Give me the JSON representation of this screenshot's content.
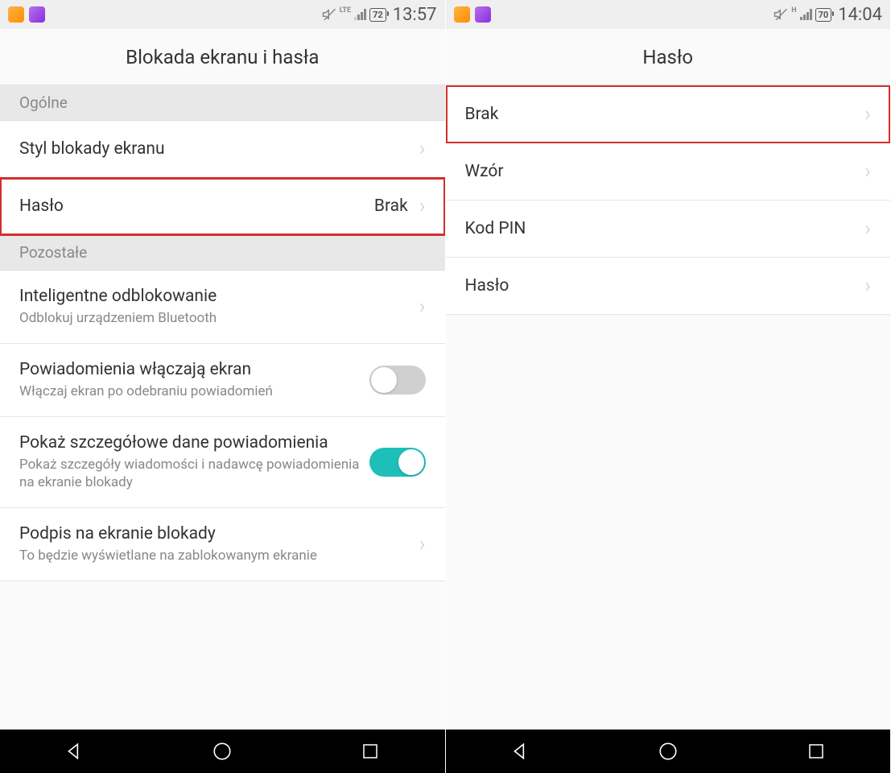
{
  "left": {
    "status": {
      "network_type": "LTE",
      "battery": "72",
      "time": "13:57"
    },
    "header": {
      "title": "Blokada ekranu i hasła"
    },
    "section1": {
      "label": "Ogólne"
    },
    "section2": {
      "label": "Pozostałe"
    },
    "rows": {
      "lockstyle": {
        "title": "Styl blokady ekranu"
      },
      "password": {
        "title": "Hasło",
        "value": "Brak"
      },
      "smartunlock": {
        "title": "Inteligentne odblokowanie",
        "subtitle": "Odblokuj urządzeniem Bluetooth"
      },
      "notif_screen": {
        "title": "Powiadomienia włączają ekran",
        "subtitle": "Włączaj ekran po odebraniu powiadomień"
      },
      "notif_detail": {
        "title": "Pokaż szczegółowe dane powiadomienia",
        "subtitle": "Pokaż szczegóły wiadomości i nadawcę powiadomienia na ekranie blokady"
      },
      "signature": {
        "title": "Podpis na ekranie blokady",
        "subtitle": "To będzie wyświetlane na zablokowanym ekranie"
      }
    }
  },
  "right": {
    "status": {
      "network_type": "H",
      "battery": "70",
      "time": "14:04"
    },
    "header": {
      "title": "Hasło"
    },
    "rows": {
      "none": {
        "title": "Brak"
      },
      "pattern": {
        "title": "Wzór"
      },
      "pin": {
        "title": "Kod PIN"
      },
      "password": {
        "title": "Hasło"
      }
    }
  }
}
